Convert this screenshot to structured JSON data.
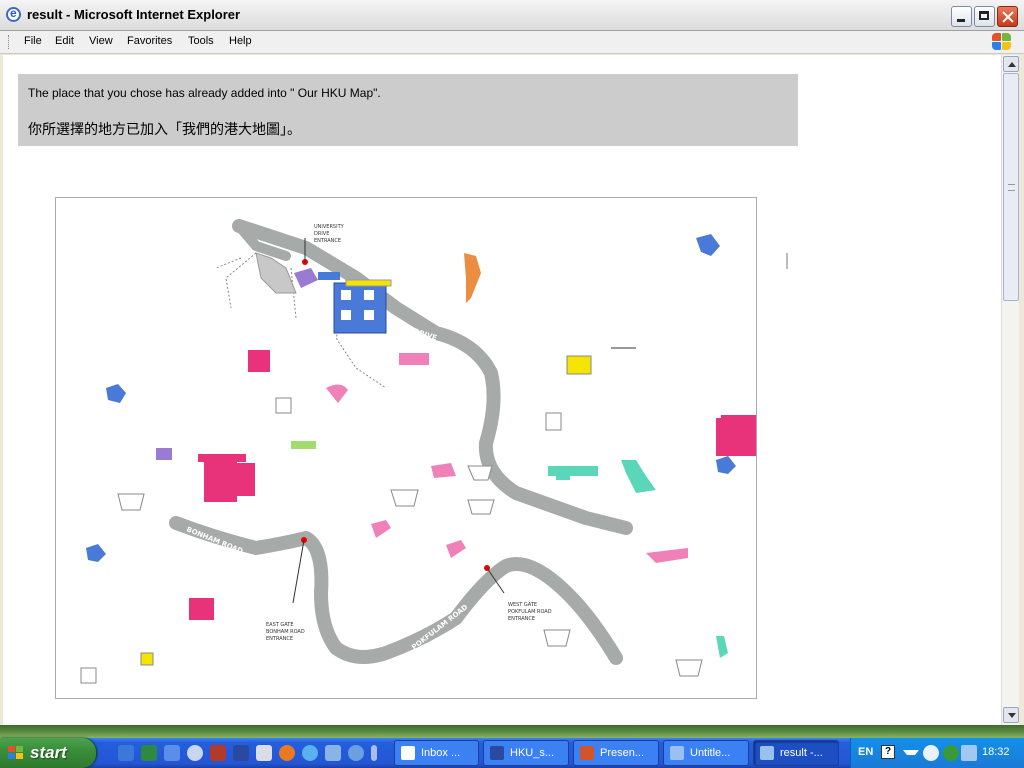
{
  "window": {
    "title": "result - Microsoft Internet Explorer"
  },
  "menu": [
    "File",
    "Edit",
    "View",
    "Favorites",
    "Tools",
    "Help"
  ],
  "page": {
    "message_en": "The place that you chose has already added into \" Our HKU Map\".",
    "message_zh": "你所選擇的地方已加入「我們的港大地圖」。"
  },
  "map": {
    "labels": {
      "university_drive_entrance": [
        "UNIVERSITY",
        "DRIVE",
        "ENTRANCE"
      ],
      "university_drive": "RSITY DRIVE",
      "bonham_road": "BONHAM ROAD",
      "pokfulam_road": "POKFULAM ROAD",
      "east_gate": [
        "EAST GATE",
        "BONHAM ROAD",
        "ENTRANCE"
      ],
      "west_gate": [
        "WEST GATE",
        "POKFULAM ROAD",
        "ENTRANCE"
      ]
    }
  },
  "taskbar": {
    "start_label": "start",
    "tasks": [
      {
        "label": "Inbox ...",
        "icon": "outlook-icon"
      },
      {
        "label": "HKU_s...",
        "icon": "word-icon"
      },
      {
        "label": "Presen...",
        "icon": "powerpoint-icon"
      },
      {
        "label": "Untitle...",
        "icon": "ie-icon"
      },
      {
        "label": "result -...",
        "icon": "ie-icon",
        "active": true
      }
    ],
    "language": "EN",
    "clock": "18:32"
  },
  "colors": {
    "road": "#a6aaa8",
    "pink": "#e8327a",
    "blue": "#4a7ad8",
    "yellow": "#f5e400",
    "teal": "#5ad6b8",
    "purple": "#9a7ad2"
  }
}
